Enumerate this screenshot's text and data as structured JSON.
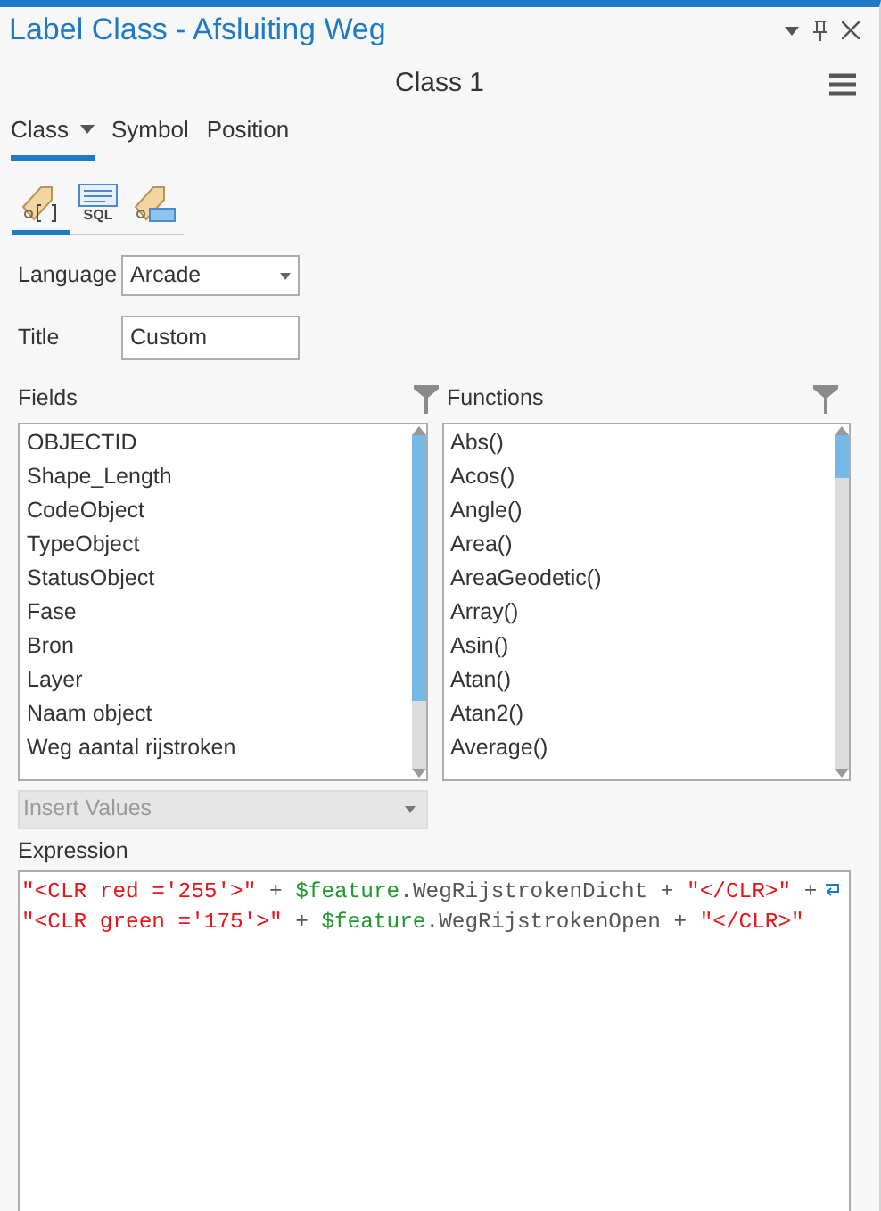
{
  "window": {
    "title": "Label Class - Afsluiting Weg"
  },
  "header": {
    "title": "Class 1"
  },
  "tabs": [
    {
      "label": "Class",
      "selected": true,
      "dropdown": true
    },
    {
      "label": "Symbol",
      "selected": false,
      "dropdown": false
    },
    {
      "label": "Position",
      "selected": false,
      "dropdown": false
    }
  ],
  "subtabs": [
    {
      "kind": "expression",
      "selected": true
    },
    {
      "kind": "sql",
      "label": "SQL",
      "selected": false
    },
    {
      "kind": "label",
      "selected": false
    }
  ],
  "language": {
    "label": "Language",
    "value": "Arcade"
  },
  "title_field": {
    "label": "Title",
    "value": "Custom"
  },
  "fields": {
    "label": "Fields",
    "items": [
      "OBJECTID",
      "Shape_Length",
      "CodeObject",
      "TypeObject",
      "StatusObject",
      "Fase",
      "Bron",
      "Layer",
      "Naam object",
      "Weg aantal rijstroken"
    ]
  },
  "functions": {
    "label": "Functions",
    "items": [
      "Abs()",
      "Acos()",
      "Angle()",
      "Area()",
      "AreaGeodetic()",
      "Array()",
      "Asin()",
      "Atan()",
      "Atan2()",
      "Average()"
    ]
  },
  "insert_values": {
    "label": "Insert Values",
    "disabled": true
  },
  "expression": {
    "label": "Expression",
    "lines": [
      [
        {
          "kind": "string",
          "text": "\"<CLR red ='255'>\""
        },
        {
          "kind": "operator",
          "text": " + "
        },
        {
          "kind": "variable",
          "text": "$feature"
        },
        {
          "kind": "member",
          "text": ".WegRijstrokenDicht"
        },
        {
          "kind": "operator",
          "text": " + "
        },
        {
          "kind": "string",
          "text": "\"</CLR>\""
        },
        {
          "kind": "operator",
          "text": " +"
        }
      ],
      [
        {
          "kind": "string",
          "text": "\"<CLR green ='175'>\""
        },
        {
          "kind": "operator",
          "text": " + "
        },
        {
          "kind": "variable",
          "text": "$feature"
        },
        {
          "kind": "member",
          "text": ".WegRijstrokenOpen"
        },
        {
          "kind": "operator",
          "text": " + "
        },
        {
          "kind": "string",
          "text": "\"</CLR>\""
        }
      ]
    ]
  }
}
